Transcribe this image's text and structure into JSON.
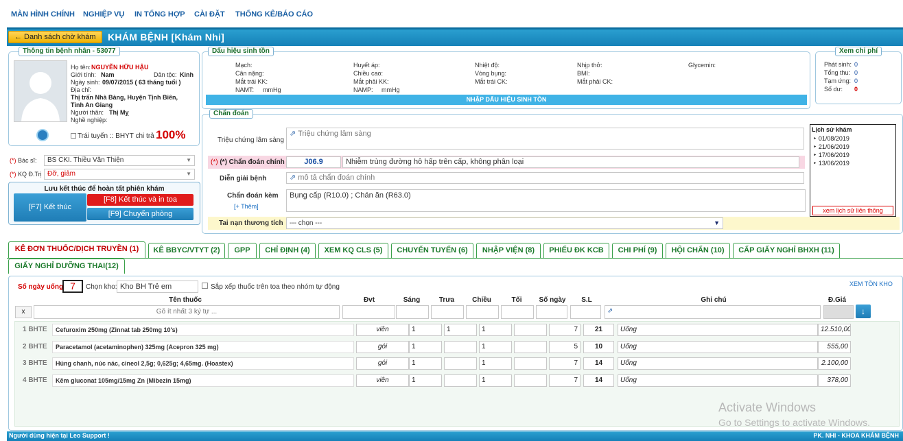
{
  "menu": [
    "MÀN HÌNH CHÍNH",
    "NGHIỆP VỤ",
    "IN TỔNG HỢP",
    "CÀI ĐẶT",
    "THỐNG KÊ/BÁO CÁO"
  ],
  "header": {
    "back_label": "← Danh sách chờ khám",
    "title": "KHÁM BỆNH [Khám Nhi]"
  },
  "patient": {
    "legend": "Thông tin bệnh nhân - 53077",
    "name_label": "Họ tên:",
    "name": "NGUYỄN HỮU HẬU",
    "gender_label": "Giới tính:",
    "gender": "Nam",
    "ethnic_label": "Dân tộc:",
    "ethnic": "Kinh",
    "dob_label": "Ngày sinh:",
    "dob": "09/07/2015 ( 63 tháng tuổi )",
    "address_label": "Địa chỉ:",
    "address_line1": "Thị trấn Nhà Bàng, Huyện Tịnh Biên,",
    "address_line2": "Tỉnh An Giang",
    "relative_label": "Người thân:",
    "relative": "Thị Mỵ",
    "job_label": "Nghề nghiệp:",
    "trai_tuyen_label": "Trái tuyến :: BHYT chi trả",
    "bhyt_percent": "100%"
  },
  "doctor": {
    "label": "Bác sĩ:",
    "value": "BS CKI. Thiều Văn Thiện",
    "kq_label": "KQ Đ.Trị",
    "kq_value": "Đỡ, giảm"
  },
  "finish": {
    "title": "Lưu kết thúc để hoàn tất phiên khám",
    "f7": "[F7] Kết thúc",
    "f8": "[F8] Kết thúc và in toa",
    "f9": "[F9] Chuyển phòng"
  },
  "vitals": {
    "legend": "Dấu hiệu sinh tồn",
    "c1": [
      "Mạch:",
      "Cân nặng:",
      "Mắt trái KK:",
      "NAMT:"
    ],
    "namt_unit": "mmHg",
    "c2": [
      "Huyết áp:",
      "Chiều cao:",
      "Mắt phải KK:",
      "NAMP:"
    ],
    "namp_unit": "mmHg",
    "c3": [
      "Nhiệt độ:",
      "Vòng bụng:",
      "Mắt trái CK:"
    ],
    "c4": [
      "Nhịp thở:",
      "BMI:",
      "Mắt phải CK:"
    ],
    "c5": [
      "Glycemin:"
    ],
    "button": "NHẬP DẤU HIỆU SINH TỒN"
  },
  "cost": {
    "legend": "Xem chi phí",
    "rows": [
      {
        "label": "Phát sinh:",
        "value": "0"
      },
      {
        "label": "Tổng thu:",
        "value": "0"
      },
      {
        "label": "Tạm ứng:",
        "value": "0"
      },
      {
        "label": "Số dư:",
        "value": "0"
      }
    ]
  },
  "diagnosis": {
    "legend": "Chẩn đoán",
    "symptom_label": "Triệu chứng lâm sàng",
    "symptom_ph": "Triệu chứng lâm sàng",
    "main_label": "(*) Chẩn đoán chính",
    "main_code": "J06.9",
    "main_text": "Nhiễm trùng đường hô hấp trên cấp, không phân loại",
    "explain_label": "Diễn giải bệnh",
    "explain_ph": "mô tả chẩn đoán chính",
    "extra_label": "Chẩn đoán kèm",
    "extra_add": "[+ Thêm]",
    "extra_text": "Bụng cấp (R10.0) ; Chán ăn (R63.0)",
    "accident_label": "Tai nạn thương tích",
    "accident_value": "--- chọn ---"
  },
  "history": {
    "title": "Lịch sử khám",
    "dates": [
      "01/08/2019",
      "21/06/2019",
      "17/06/2019",
      "13/06/2019"
    ],
    "link": "xem lịch sử liên thông"
  },
  "tabs": [
    "KÊ ĐƠN THUỐC/DỊCH TRUYỀN (1)",
    "KÊ BBYC/VTYT (2)",
    "GPP",
    "CHỈ ĐỊNH (4)",
    "XEM KQ CLS (5)",
    "CHUYỂN TUYẾN (6)",
    "NHẬP VIỆN (8)",
    "PHIẾU ĐK KCB",
    "CHI PHÍ (9)",
    "HỘI CHẨN (10)",
    "CẤP GIẤY NGHỈ BHXH (11)",
    "GIẤY NGHỈ DƯỠNG THAI(12)"
  ],
  "rx": {
    "days_label": "Số ngày uống",
    "days": "7",
    "store_label": "Chọn kho:",
    "store": "Kho BH Trẻ em",
    "sort_label": "Sắp xếp thuốc trên toa theo nhóm tự động",
    "stock_link": "XEM TỒN KHO",
    "columns": [
      "Tên thuốc",
      "Đvt",
      "Sáng",
      "Trưa",
      "Chiều",
      "Tối",
      "Số ngày",
      "S.L",
      "Ghi chú",
      "Đ.Giá"
    ],
    "search_ph": "Gõ ít nhất 3 ký tự ...",
    "clear": "x",
    "rows": [
      {
        "no": "1 BHTE",
        "name": "Cefuroxim 250mg (Zinnat tab 250mg 10's)",
        "unit": "viên",
        "sang": "1",
        "trua": "1",
        "chieu": "1",
        "toi": "",
        "days": "7",
        "qty": "21",
        "note": "Uống",
        "price": "12.510,00"
      },
      {
        "no": "2 BHTE",
        "name": "Paracetamol (acetaminophen) 325mg (Acepron 325 mg)",
        "unit": "gói",
        "sang": "1",
        "trua": "",
        "chieu": "1",
        "toi": "",
        "days": "5",
        "qty": "10",
        "note": "Uống",
        "price": "555,00"
      },
      {
        "no": "3 BHTE",
        "name": "Húng chanh, núc nác, cineol 2,5g; 0,625g; 4,65mg. (Hoastex)",
        "unit": "gói",
        "sang": "1",
        "trua": "",
        "chieu": "1",
        "toi": "",
        "days": "7",
        "qty": "14",
        "note": "Uống",
        "price": "2.100,00"
      },
      {
        "no": "4 BHTE",
        "name": "Kẽm gluconat 105mg/15mg Zn (Mibezin 15mg)",
        "unit": "viên",
        "sang": "1",
        "trua": "",
        "chieu": "1",
        "toi": "",
        "days": "7",
        "qty": "14",
        "note": "Uống",
        "price": "378,00"
      }
    ]
  },
  "footer": {
    "left": "Người dùng hiện tại Leo Support !",
    "right": "PK. NHI - KHOA KHÁM BỆNH"
  },
  "watermark": {
    "line1": "Activate Windows",
    "line2": "Go to Settings to activate Windows."
  }
}
